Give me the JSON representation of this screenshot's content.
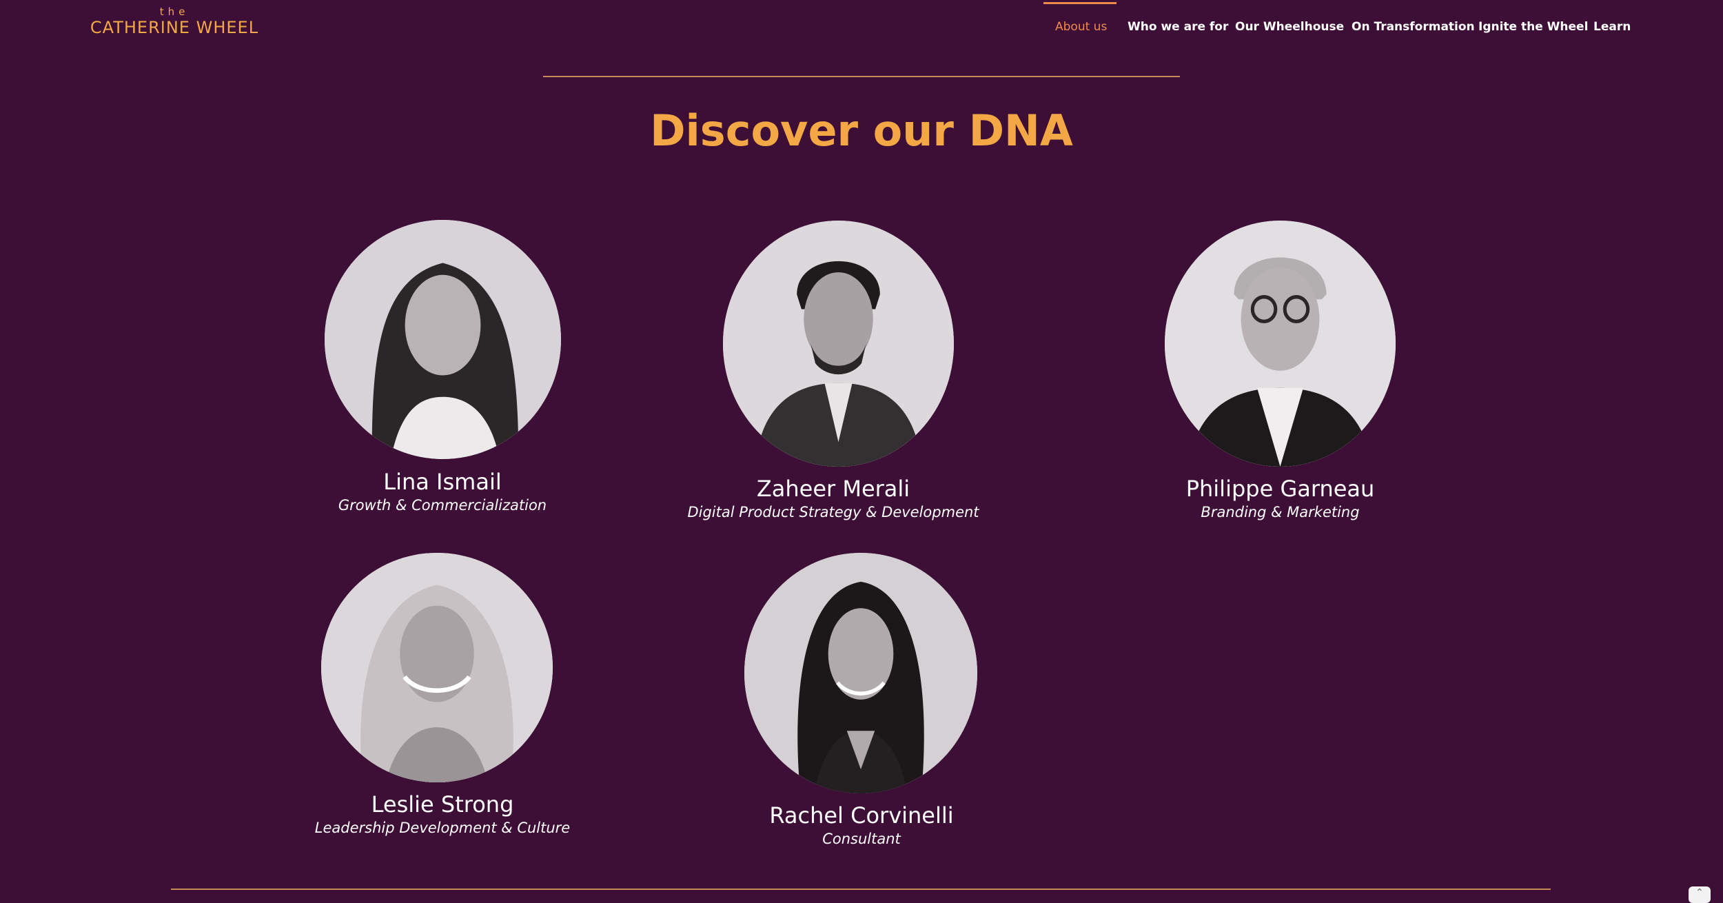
{
  "header": {
    "logo_the": "the",
    "logo_main": "CATHERINE WHEEL",
    "nav": [
      {
        "label": "About us",
        "active": true
      },
      {
        "label": "Who we are for",
        "active": false
      },
      {
        "label": "Our Wheelhouse",
        "active": false
      },
      {
        "label": "On Transformation",
        "active": false
      },
      {
        "label": "Ignite the Wheel",
        "active": false
      },
      {
        "label": "Learn",
        "active": false
      }
    ]
  },
  "main": {
    "title": "Discover our DNA",
    "members": [
      {
        "name": "Lina Ismail",
        "role": "Growth & Commercialization"
      },
      {
        "name": "Zaheer Merali",
        "role": "Digital Product Strategy & Development"
      },
      {
        "name": "Philippe Garneau",
        "role": "Branding & Marketing"
      },
      {
        "name": "Leslie Strong",
        "role": "Leadership Development & Culture"
      },
      {
        "name": "Rachel Corvinelli",
        "role": "Consultant"
      }
    ]
  },
  "icons": {
    "scroll_top": "chevron-up-icon"
  },
  "colors": {
    "background": "#3d0f36",
    "accent": "#f4a845",
    "active_nav": "#f08a4b",
    "rule": "#c78a54"
  }
}
